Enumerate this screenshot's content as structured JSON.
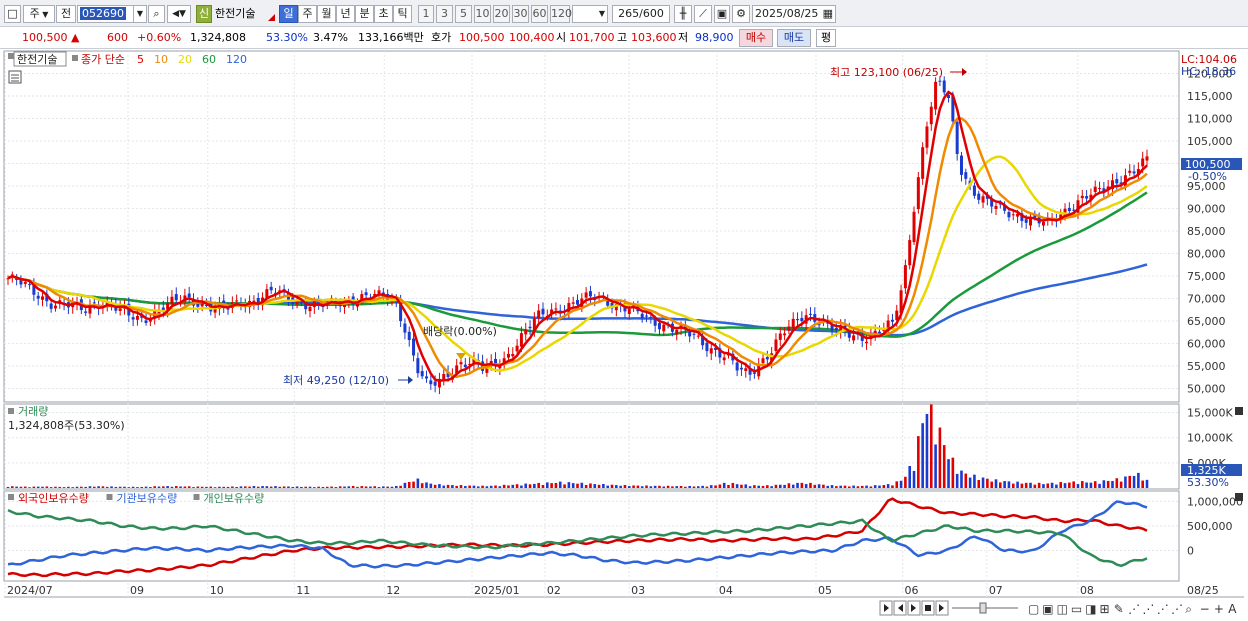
{
  "toolbar": {
    "market_select": "주",
    "market_mode": "전",
    "code": "052690",
    "badge": "신",
    "stock_name": "한전기술",
    "periods": [
      "일",
      "주",
      "월",
      "년",
      "분",
      "초",
      "틱"
    ],
    "selected_period": "일",
    "intervals": [
      "1",
      "3",
      "5",
      "10",
      "20",
      "30",
      "60",
      "120"
    ],
    "count": "265",
    "count_total": "/600",
    "date": "2025/08/25"
  },
  "quote": {
    "price": "100,500",
    "change_arrow": "▲",
    "change": "600",
    "change_pct": "+0.60%",
    "volume": "1,324,808",
    "vol_ratio": "53.30%",
    "turnover": "3.47%",
    "amount": "133,166백만",
    "hoga_label": "호가",
    "ask": "100,500",
    "bid": "100,400",
    "open_label": "시",
    "open": "101,700",
    "high_label": "고",
    "high": "103,600",
    "low_label": "저",
    "low": "98,900",
    "buy_label": "매수",
    "sell_label": "매도",
    "eval_label": "평"
  },
  "price_panel": {
    "stock_tag": "한전기술",
    "ma_label": "종가 단순",
    "ma_periods": [
      {
        "label": "5",
        "color": "#e00000"
      },
      {
        "label": "10",
        "color": "#f08a00"
      },
      {
        "label": "20",
        "color": "#e8d800"
      },
      {
        "label": "60",
        "color": "#1a9a3a"
      },
      {
        "label": "120",
        "color": "#2f63d8"
      }
    ],
    "lc": "LC:104.06",
    "hc": "HC:-18.36",
    "max_annotation": "최고 123,100 (06/25)",
    "min_annotation": "최저 49,250 (12/10)",
    "dividend_annotation": "배당락(0.00%)",
    "current_price_tag": "100,500",
    "current_change_tag": "-0.50%",
    "y_ticks": [
      "120,000",
      "115,000",
      "110,000",
      "105,000",
      "100,000",
      "95,000",
      "90,000",
      "85,000",
      "80,000",
      "75,000",
      "70,000",
      "65,000",
      "60,000",
      "55,000",
      "50,000"
    ]
  },
  "volume_panel": {
    "title": "거래량",
    "value": "1,324,808주(53.30%)",
    "y_ticks": [
      "15,000K",
      "10,000K",
      "5,000K"
    ],
    "current_tag": "1,325K",
    "current_pct": "53.30%"
  },
  "holdings_panel": {
    "legend": [
      {
        "label": "외국인보유수량",
        "color": "#d40000"
      },
      {
        "label": "기관보유수량",
        "color": "#2f63d8"
      },
      {
        "label": "개인보유수량",
        "color": "#2e8b57"
      }
    ],
    "y_ticks": [
      "1,000,000",
      "500,000",
      "0"
    ]
  },
  "x_axis": {
    "ticks": [
      "2024/07",
      "09",
      "10",
      "11",
      "12",
      "2025/01",
      "02",
      "03",
      "04",
      "05",
      "06",
      "07",
      "08"
    ],
    "end_label": "08/25"
  },
  "chart_data": {
    "type": "line",
    "title": "한전기술",
    "y_unit": "KRW",
    "ylim": [
      47000,
      125000
    ],
    "x_range": [
      "2024/07",
      "2025/08/25"
    ],
    "max": {
      "value": 123100,
      "date": "06/25"
    },
    "min": {
      "value": 49250,
      "date": "12/10"
    },
    "last_close": 100500,
    "close_approx": [
      74500,
      73500,
      72000,
      70500,
      69000,
      68500,
      68000,
      67500,
      69500,
      68500,
      67500,
      66000,
      65500,
      66500,
      68000,
      69000,
      70000,
      69500,
      68500,
      67500,
      68000,
      69000,
      69500,
      70500,
      71500,
      70500,
      69500,
      69000,
      68500,
      68500,
      69000,
      70000,
      70500,
      70500,
      70000,
      69500,
      63000,
      54500,
      50000,
      51500,
      54000,
      56000,
      55500,
      54000,
      55500,
      57000,
      60000,
      63000,
      66000,
      67500,
      68000,
      68500,
      69500,
      70500,
      70000,
      68500,
      67500,
      66500,
      65500,
      64500,
      63500,
      62500,
      61500,
      60000,
      58500,
      57000,
      54000,
      53000,
      56000,
      58500,
      62000,
      64000,
      66500,
      66000,
      64000,
      62500,
      62000,
      61500,
      62000,
      63000,
      64000,
      74000,
      92000,
      108000,
      118000,
      115000,
      100000,
      95000,
      92000,
      90500,
      89500,
      89000,
      88000,
      87000,
      86500,
      88500,
      90500,
      92000,
      93000,
      94000,
      96000,
      97500,
      98500,
      100500
    ],
    "series": [
      {
        "name": "5",
        "role": "moving average"
      },
      {
        "name": "10",
        "role": "moving average"
      },
      {
        "name": "20",
        "role": "moving average"
      },
      {
        "name": "60",
        "role": "moving average"
      },
      {
        "name": "120",
        "role": "moving average"
      }
    ],
    "volume_k_approx": [
      300,
      250,
      200,
      260,
      220,
      180,
      200,
      240,
      300,
      260,
      220,
      200,
      180,
      260,
      300,
      320,
      280,
      240,
      220,
      200,
      220,
      260,
      300,
      320,
      300,
      260,
      240,
      220,
      200,
      220,
      260,
      320,
      300,
      280,
      260,
      240,
      900,
      1500,
      800,
      600,
      500,
      450,
      400,
      350,
      400,
      500,
      600,
      700,
      800,
      900,
      1000,
      900,
      800,
      700,
      600,
      500,
      450,
      400,
      380,
      360,
      340,
      320,
      300,
      350,
      500,
      900,
      700,
      500,
      400,
      450,
      600,
      800,
      900,
      700,
      500,
      400,
      380,
      360,
      400,
      500,
      700,
      1600,
      5000,
      14800,
      11000,
      6000,
      3000,
      2200,
      1800,
      1400,
      1200,
      1000,
      900,
      800,
      800,
      900,
      1000,
      1100,
      1000,
      1200,
      1400,
      1800,
      2600,
      1325
    ],
    "holdings": [
      {
        "name": "외국인보유수량",
        "values_approx": [
          -480000,
          -500000,
          -480000,
          -470000,
          -420000,
          -400000,
          -350000,
          -300000,
          -200000,
          -100000,
          0,
          50000,
          60000,
          70000,
          80000,
          100000,
          120000,
          110000,
          100000,
          120000,
          150000,
          180000,
          200000,
          220000,
          230000,
          200000,
          220000,
          240000,
          230000,
          300000,
          400000,
          1050000,
          900000,
          760000,
          740000,
          700000,
          680000,
          600000,
          620000,
          500000,
          420000
        ]
      },
      {
        "name": "기관보유수량",
        "values_approx": [
          -300000,
          -200000,
          -100000,
          -50000,
          0,
          50000,
          30000,
          0,
          50000,
          80000,
          100000,
          50000,
          -300000,
          -320000,
          -300000,
          -250000,
          -200000,
          -150000,
          -100000,
          -50000,
          -100000,
          -200000,
          -250000,
          -230000,
          -200000,
          -150000,
          -100000,
          -50000,
          -20000,
          0,
          200000,
          250000,
          -100000,
          0,
          300000,
          0,
          -20000,
          400000,
          600000,
          1000000,
          900000
        ]
      },
      {
        "name": "개인보유수량",
        "values_approx": [
          800000,
          700000,
          650000,
          600000,
          500000,
          450000,
          450000,
          500000,
          400000,
          300000,
          200000,
          150000,
          150000,
          200000,
          150000,
          100000,
          80000,
          60000,
          120000,
          150000,
          200000,
          250000,
          300000,
          330000,
          350000,
          380000,
          400000,
          450000,
          500000,
          550000,
          600000,
          200000,
          350000,
          500000,
          400000,
          400000,
          380000,
          350000,
          -100000,
          -300000,
          -150000
        ]
      }
    ]
  }
}
